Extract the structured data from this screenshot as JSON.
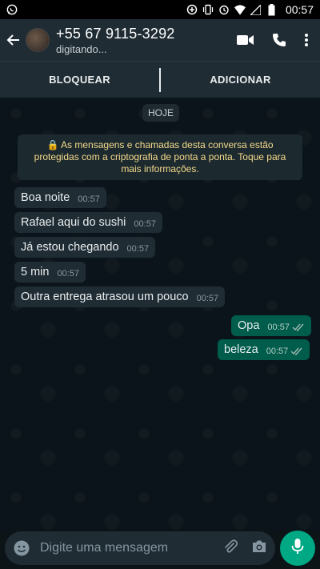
{
  "statusbar": {
    "time": "00:57"
  },
  "header": {
    "contact_name": "+55 67 9115-3292",
    "contact_status": "digitando..."
  },
  "actions": {
    "block_label": "BLOQUEAR",
    "add_label": "ADICIONAR"
  },
  "chat": {
    "day_label": "HOJE",
    "encryption_notice": "🔒 As mensagens e chamadas desta conversa estão protegidas com a criptografia de ponta a ponta. Toque para mais informações.",
    "messages": [
      {
        "direction": "in",
        "text": "Boa noite",
        "time": "00:57"
      },
      {
        "direction": "in",
        "text": "Rafael aqui do sushi",
        "time": "00:57"
      },
      {
        "direction": "in",
        "text": "Já estou chegando",
        "time": "00:57"
      },
      {
        "direction": "in",
        "text": "5 min",
        "time": "00:57"
      },
      {
        "direction": "in",
        "text": "Outra entrega atrasou um pouco",
        "time": "00:57"
      },
      {
        "direction": "out",
        "text": "Opa",
        "time": "00:57",
        "status": "read"
      },
      {
        "direction": "out",
        "text": "beleza",
        "time": "00:57",
        "status": "read"
      }
    ]
  },
  "composer": {
    "placeholder": "Digite uma mensagem"
  },
  "colors": {
    "header_bg": "#1f2c34",
    "chat_bg": "#0b141a",
    "outgoing_bubble": "#005c4b",
    "incoming_bubble": "#1f2c34",
    "accent": "#00a884",
    "notice_text": "#f5d98b"
  },
  "icons": {
    "status_left": "whatsapp-notification-icon",
    "status_right": [
      "data-saver-icon",
      "vibrate-icon",
      "alarm-icon",
      "wifi-icon",
      "signal-icon",
      "battery-icon"
    ],
    "header": [
      "back-arrow-icon",
      "video-call-icon",
      "phone-call-icon",
      "more-vert-icon"
    ],
    "composer": [
      "emoji-icon",
      "attach-icon",
      "camera-icon",
      "mic-icon"
    ]
  }
}
